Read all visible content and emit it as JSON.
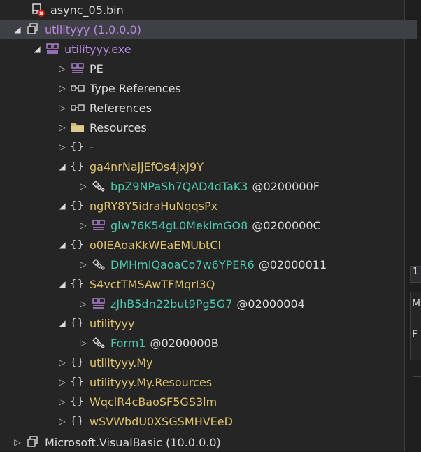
{
  "tree": {
    "rows": [
      {
        "label": "async_05.bin",
        "arrow": "",
        "icon": "error-file-icon",
        "color": "#dcdcdc"
      },
      {
        "label": "utilityyy (1.0.0.0)",
        "arrow": "◢",
        "icon": "assembly-icon",
        "color": "#b888e0"
      },
      {
        "label": "utilityyy.exe",
        "arrow": "◢",
        "icon": "module-icon",
        "color": "#b888e0"
      },
      {
        "label": "PE",
        "arrow": "▷",
        "icon": "module-icon",
        "color": "#dcdcdc"
      },
      {
        "label": "Type References",
        "arrow": "▷",
        "icon": "references-icon",
        "color": "#dcdcdc"
      },
      {
        "label": "References",
        "arrow": "▷",
        "icon": "references-icon",
        "color": "#dcdcdc"
      },
      {
        "label": "Resources",
        "arrow": "▷",
        "icon": "folder-icon",
        "color": "#dcdcdc"
      },
      {
        "label": "-",
        "arrow": "▷",
        "icon": "namespace-icon",
        "color": "#dcdcdc"
      },
      {
        "label": "ga4nrNajjEfOs4jxJ9Y",
        "arrow": "◢",
        "icon": "namespace-icon",
        "color": "#e0c46c"
      },
      {
        "label": "bpZ9NPaSh7QAD4dTaK3",
        "token": "@0200000F",
        "arrow": "▷",
        "icon": "class-icon",
        "color": "#4ec9b0"
      },
      {
        "label": "ngRY8Y5idraHuNqqsPx",
        "arrow": "◢",
        "icon": "namespace-icon",
        "color": "#e0c46c"
      },
      {
        "label": "glw76K54gL0MekimGO8",
        "token": "@0200000C",
        "arrow": "▷",
        "icon": "module-class-icon",
        "color": "#4ec9b0"
      },
      {
        "label": "o0lEAoaKkWEaEMUbtCl",
        "arrow": "◢",
        "icon": "namespace-icon",
        "color": "#e0c46c"
      },
      {
        "label": "DMHmIQaoaCo7w6YPER6",
        "token": "@02000011",
        "arrow": "▷",
        "icon": "class-icon",
        "color": "#4ec9b0"
      },
      {
        "label": "S4vctTMSAwTFMqrI3Q",
        "arrow": "◢",
        "icon": "namespace-icon",
        "color": "#e0c46c"
      },
      {
        "label": "zJhB5dn22but9Pg5G7",
        "token": "@02000004",
        "arrow": "▷",
        "icon": "module-class-icon",
        "color": "#4ec9b0"
      },
      {
        "label": "utilityyy",
        "arrow": "◢",
        "icon": "namespace-icon",
        "color": "#e0c46c"
      },
      {
        "label": "Form1",
        "token": "@0200000B",
        "arrow": "▷",
        "icon": "class-icon",
        "color": "#4ec9b0"
      },
      {
        "label": "utilityyy.My",
        "arrow": "▷",
        "icon": "namespace-icon",
        "color": "#e0c46c"
      },
      {
        "label": "utilityyy.My.Resources",
        "arrow": "▷",
        "icon": "namespace-icon",
        "color": "#e0c46c"
      },
      {
        "label": "WqclR4cBaoSF5GS3lm",
        "arrow": "▷",
        "icon": "namespace-icon",
        "color": "#e0c46c"
      },
      {
        "label": "wSVWbdU0XSGSMHVEeD",
        "arrow": "▷",
        "icon": "namespace-icon",
        "color": "#e0c46c"
      },
      {
        "label": "Microsoft.VisualBasic (10.0.0.0)",
        "arrow": "▷",
        "icon": "assembly-icon",
        "color": "#dcdcdc"
      }
    ]
  },
  "side": {
    "tab_text": "1",
    "panel_line1": "M",
    "panel_line2": "F"
  }
}
